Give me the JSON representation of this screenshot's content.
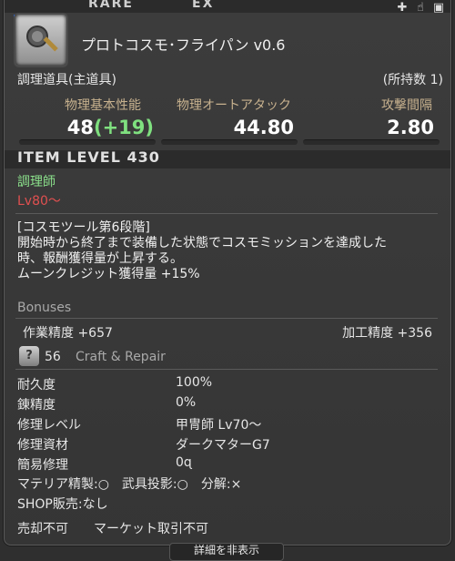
{
  "header": {
    "rarity": "RARE",
    "ex": "EX"
  },
  "item": {
    "name": "プロトコスモ･フライパン v0.6",
    "category": "調理道具(主道具)",
    "owned": "(所持数 1)"
  },
  "stats": [
    {
      "label": "物理基本性能",
      "value": "48",
      "bonus": "(+19)"
    },
    {
      "label": "物理オートアタック",
      "value": "44.80"
    },
    {
      "label": "攻撃間隔",
      "value": "2.80"
    }
  ],
  "item_level": "ITEM LEVEL 430",
  "job": "調理師",
  "level_req": "Lv80～",
  "description": {
    "lines": [
      "[コスモツール第6段階]",
      "開始時から終了まで装備した状態でコスモミッションを達成した",
      "時、報酬獲得量が上昇する。",
      "ムーンクレジット獲得量 +15%"
    ]
  },
  "bonuses": {
    "title": "Bonuses",
    "left": "作業精度 +657",
    "right": "加工精度 +356"
  },
  "craft_repair": {
    "num": "56",
    "label": "Craft & Repair"
  },
  "details": [
    {
      "label": "耐久度",
      "value": "100%"
    },
    {
      "label": "錬精度",
      "value": "0%"
    },
    {
      "label": "修理レベル",
      "value": "甲冑師 Lv70～"
    },
    {
      "label": "修理資材",
      "value": "ダークマターG7"
    },
    {
      "label": "簡易修理",
      "value": "0ɋ"
    }
  ],
  "flags": {
    "line1": "マテリア精製:○　武具投影:○　分解:×",
    "line2": "SHOP販売:なし",
    "line3": "売却不可　　マーケット取引不可"
  },
  "footer": {
    "toggle": "詳細を非表示"
  }
}
